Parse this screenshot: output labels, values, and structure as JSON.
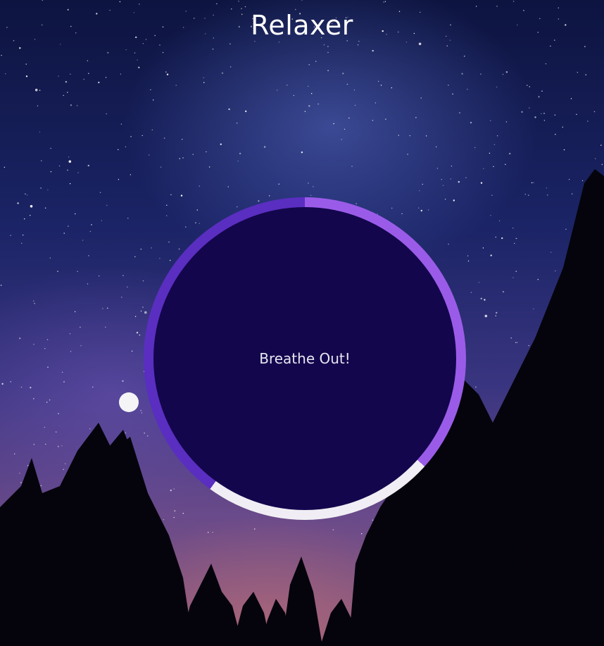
{
  "app": {
    "title": "Relaxer"
  },
  "breathing": {
    "instruction": "Breathe Out!"
  },
  "colors": {
    "ring_breathe_in": "#9a5ce8",
    "ring_hold": "#f0eef4",
    "ring_breathe_out": "#5a2ec0",
    "core": "#13064d",
    "pointer": "#f4f4f6"
  },
  "background": {
    "scene": "starry-night-sky-with-pine-trees"
  }
}
